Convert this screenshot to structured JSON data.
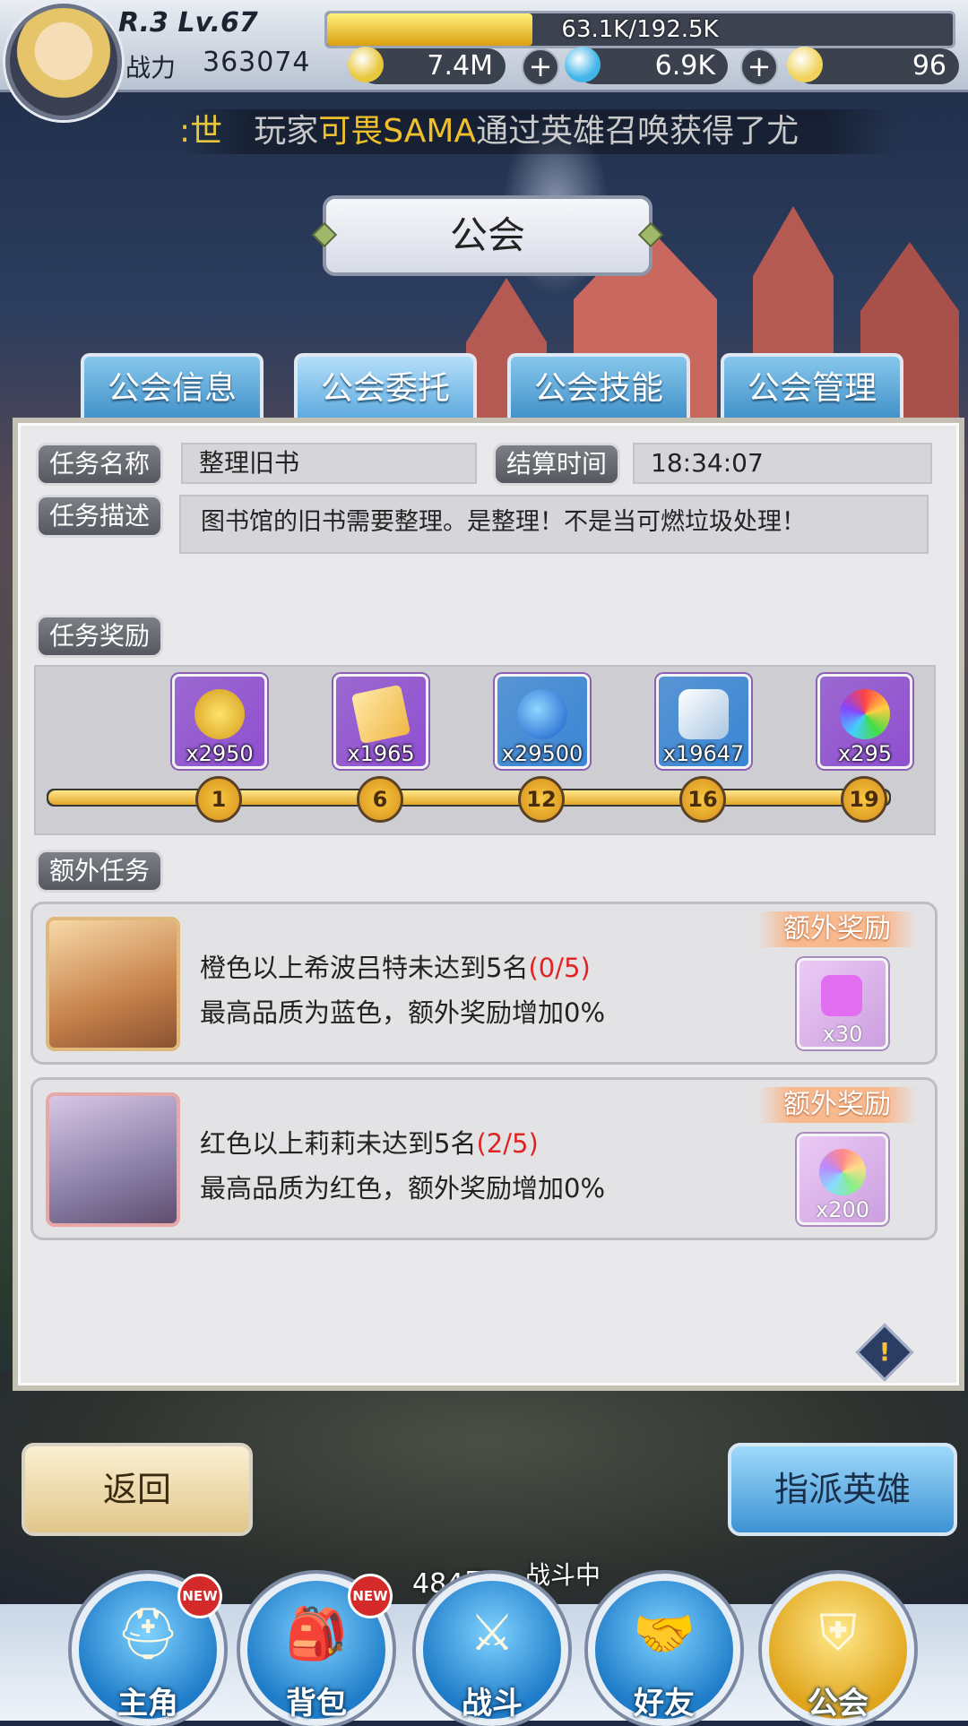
{
  "player": {
    "rank_level": "R.3 Lv.67",
    "power_label": "战力",
    "power_value": "363074",
    "exp_text": "63.1K/192.5K",
    "exp_fraction": 0.328
  },
  "currencies": [
    {
      "name": "gold",
      "value": "7.4M",
      "color": "#e8c73a"
    },
    {
      "name": "diamond",
      "value": "6.9K",
      "color": "#3fb5e8"
    },
    {
      "name": "crystal",
      "value": "96",
      "color": "#f1d35a"
    }
  ],
  "ticker": {
    "prefix": ":世",
    "message_start": "玩家",
    "player_name": "可畏SAMA",
    "message_end": "通过英雄召唤获得了尤"
  },
  "title": "公会",
  "tabs": [
    {
      "label": "公会信息"
    },
    {
      "label": "公会委托"
    },
    {
      "label": "公会技能"
    },
    {
      "label": "公会管理"
    }
  ],
  "task": {
    "name_label": "任务名称",
    "name_value": "整理旧书",
    "time_label": "结算时间",
    "time_value": "18:34:07",
    "desc_label": "任务描述",
    "desc_value": "图书馆的旧书需要整理。是整理！不是当可燃垃圾处理！",
    "reward_label": "任务奖励"
  },
  "rewards": [
    {
      "name": "gold-bag",
      "count": "x2950",
      "bg": "#8f4fd0",
      "milestone": "1"
    },
    {
      "name": "scroll",
      "count": "x1965",
      "bg": "#8f4fd0",
      "milestone": "6"
    },
    {
      "name": "exp-potion",
      "count": "x29500",
      "bg": "#3a86d4",
      "milestone": "12"
    },
    {
      "name": "ore",
      "count": "x19647",
      "bg": "#3a86d4",
      "milestone": "16"
    },
    {
      "name": "rainbow-badge",
      "count": "x295",
      "bg": "#8f4fd0",
      "milestone": "19"
    }
  ],
  "extra": {
    "label": "额外任务",
    "tasks": [
      {
        "condition_text": "橙色以上希波吕特未达到5名",
        "progress": "(0/5)",
        "quality_text": "最高品质为蓝色，额外奖励增加0%",
        "reward_tag": "额外奖励",
        "reward_count": "x30"
      },
      {
        "condition_text": "红色以上莉莉未达到5名",
        "progress": "(2/5)",
        "quality_text": "最高品质为红色，额外奖励增加0%",
        "reward_tag": "额外奖励",
        "reward_count": "x200"
      }
    ]
  },
  "buttons": {
    "back": "返回",
    "assign": "指派英雄"
  },
  "nav": {
    "battle_floor": "484层",
    "battle_state": "战斗中",
    "items": [
      {
        "label": "主角",
        "badge": "NEW"
      },
      {
        "label": "背包",
        "badge": "NEW"
      },
      {
        "label": "战斗",
        "badge": ""
      },
      {
        "label": "好友",
        "badge": ""
      },
      {
        "label": "公会",
        "badge": ""
      }
    ]
  }
}
